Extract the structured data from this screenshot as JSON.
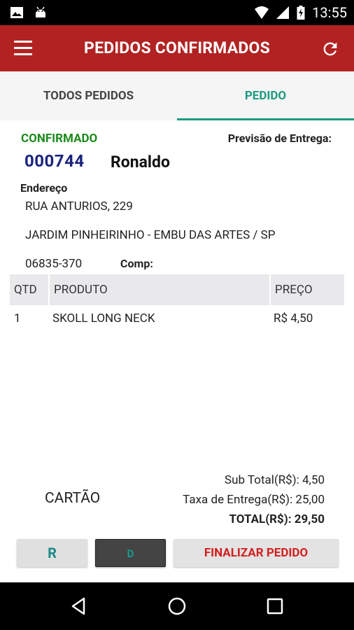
{
  "status_bar": {
    "time": "13:55",
    "icons": [
      "image-icon",
      "android-icon",
      "wifi-icon",
      "signal-icon",
      "battery-icon"
    ]
  },
  "appbar": {
    "title": "PEDIDOS CONFIRMADOS",
    "color": "#b22222"
  },
  "tabs": [
    {
      "label": "TODOS PEDIDOS",
      "selected": false
    },
    {
      "label": "PEDIDO",
      "selected": true
    }
  ],
  "order": {
    "status": "CONFIRMADO",
    "previsao_label": "Previsão de Entrega:",
    "number": "000744",
    "customer": "Ronaldo",
    "endereco_label": "Endereço",
    "address_line1": "RUA ANTURIOS, 229",
    "address_line2": "JARDIM PINHEIRINHO - EMBU DAS ARTES / SP",
    "cep": "06835-370",
    "comp_label": "Comp:"
  },
  "table": {
    "headers": {
      "qtd": "QTD",
      "produto": "PRODUTO",
      "preco": "PREÇO"
    },
    "rows": [
      {
        "qtd": "1",
        "produto": "SKOLL LONG NECK",
        "preco": "R$ 4,50"
      }
    ]
  },
  "payment": {
    "method": "CARTÃO"
  },
  "totals": {
    "subtotal": "Sub Total(R$): 4,50",
    "taxa": "Taxa de Entrega(R$): 25,00",
    "total": "TOTAL(R$): 29,50"
  },
  "buttons": {
    "r": "R",
    "d": "D",
    "finalizar": "FINALIZAR PEDIDO"
  }
}
